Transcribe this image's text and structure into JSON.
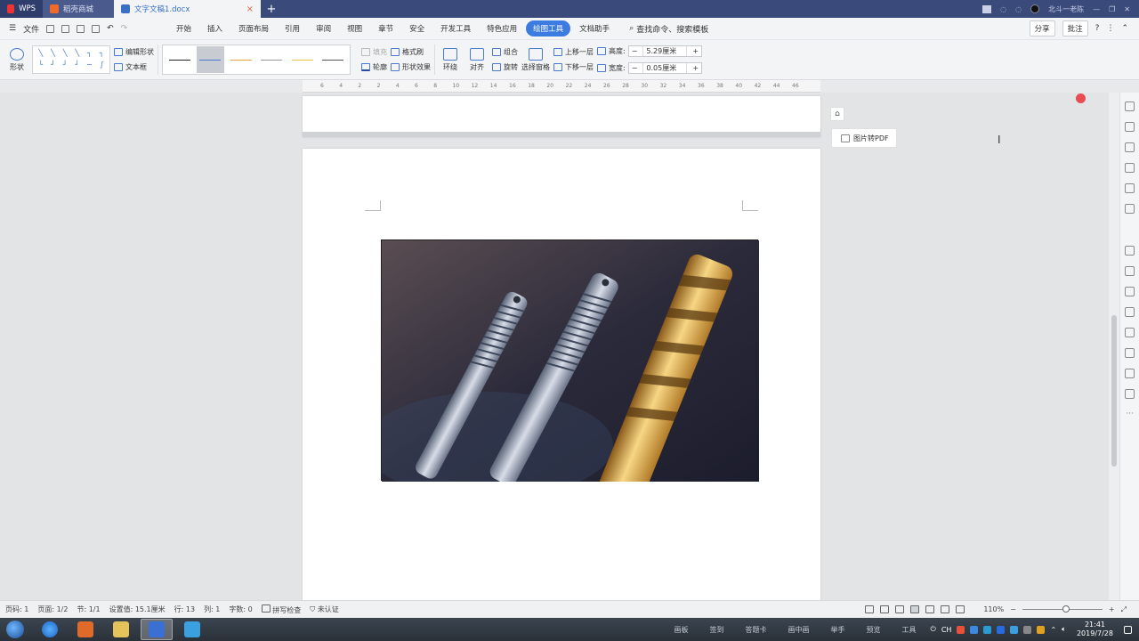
{
  "tabs": {
    "wps": "WPS",
    "store": "稻壳商城",
    "doc": "文字文稿1.docx",
    "new_tab": "+",
    "user": "北斗一老陈"
  },
  "menubar": {
    "file": "文件",
    "items": [
      "开始",
      "插入",
      "页面布局",
      "引用",
      "审阅",
      "视图",
      "章节",
      "安全",
      "开发工具",
      "特色应用",
      "绘图工具",
      "文档助手"
    ],
    "active_index": 10,
    "search": "查找命令、搜索模板",
    "share": "分享",
    "comment": "批注",
    "help": "?"
  },
  "ribbon": {
    "shape": "形状",
    "edit_shape": "编辑形状",
    "textbox": "文本框",
    "fill": "填充",
    "format_brush": "格式刷",
    "outline": "轮廓",
    "shape_effect": "形状效果",
    "wrap": "环绕",
    "align": "对齐",
    "group": "组合",
    "rotate": "旋转",
    "selection_pane": "选择窗格",
    "bring_forward": "上移一层",
    "send_backward": "下移一层",
    "height_label": "高度:",
    "height_value": "5.29厘米",
    "width_label": "宽度:",
    "width_value": "0.05厘米",
    "minus": "−",
    "plus": "+"
  },
  "ruler_ticks": [
    "6",
    "4",
    "2",
    "2",
    "4",
    "6",
    "8",
    "10",
    "12",
    "14",
    "16",
    "18",
    "20",
    "22",
    "24",
    "26",
    "28",
    "30",
    "32",
    "34",
    "36",
    "38",
    "40",
    "42",
    "44",
    "46"
  ],
  "side": {
    "pdf_button": "图片转PDF"
  },
  "statusbar": {
    "page": "页码: 1",
    "pages": "页面: 1/2",
    "section": "节: 1/1",
    "position": "设置值: 15.1厘米",
    "row": "行: 13",
    "col": "列: 1",
    "words": "字数: 0",
    "spell": "拼写检查",
    "auth": "未认证",
    "zoom": "110%",
    "zoom_minus": "−",
    "zoom_plus": "+"
  },
  "taskbar": {
    "labels": [
      "画板",
      "签到",
      "答题卡",
      "画中画",
      "举手",
      "预览",
      "工具"
    ],
    "time": "21:41",
    "date": "2019/7/28",
    "lang": "CH"
  },
  "colors": {
    "accent": "#3c7be0",
    "tabbar": "#3a4a7a",
    "record_dot": "#e84b52"
  }
}
